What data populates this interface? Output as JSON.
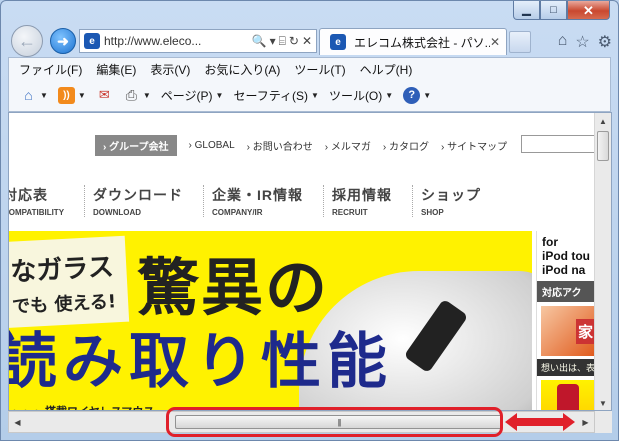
{
  "window": {
    "caption_buttons": {
      "minimize": "▁",
      "maximize": "□",
      "close": "✕"
    }
  },
  "nav": {
    "back_glyph": "←",
    "forward_glyph": "➜",
    "address": {
      "site_icon": "elecom-favicon",
      "url": "http://www.eleco...",
      "search_glyph": "🔍",
      "dropdown_glyph": "▾",
      "compat_glyph": "⌸",
      "refresh_glyph": "↻",
      "stop_glyph": "✕"
    },
    "tab": {
      "title": "エレコム株式会社 - パソ...",
      "close_glyph": "✕"
    },
    "right_icons": [
      "home-icon",
      "favorites-star-icon",
      "tools-gear-icon"
    ]
  },
  "menu_bar": [
    "ファイル(F)",
    "編集(E)",
    "表示(V)",
    "お気に入り(A)",
    "ツール(T)",
    "ヘルプ(H)"
  ],
  "command_bar": {
    "page": "ページ(P)",
    "safety": "セーフティ(S)",
    "tools": "ツール(O)"
  },
  "page": {
    "util_nav": {
      "group": "グループ会社",
      "links": [
        "GLOBAL",
        "お問い合わせ",
        "メルマガ",
        "カタログ",
        "サイトマップ"
      ],
      "prefix": "›"
    },
    "main_nav": [
      {
        "jp": "対応表",
        "en": "COMPATIBILITY"
      },
      {
        "jp": "ダウンロード",
        "en": "DOWNLOAD"
      },
      {
        "jp": "企業・IR情報",
        "en": "COMPANY/IR"
      },
      {
        "jp": "採用情報",
        "en": "RECRUIT"
      },
      {
        "jp": "ショップ",
        "en": "SHOP"
      }
    ],
    "banner": {
      "line1": "なガラス",
      "line2": "でも 使える!",
      "headline1": "驚異の",
      "headline2": "読み取り性能",
      "tag": "・・・ 搭載ワイヤレスマウス"
    },
    "side_ad": {
      "head1": "for",
      "head2": "iPod tou",
      "head3": "iPod na",
      "strip": "対応アク",
      "pic_text": "家",
      "note": "想い出は、表"
    }
  },
  "colors": {
    "banner_yellow": "#fff200",
    "headline_navy": "#1e2a8c",
    "highlight_red": "#e0202a",
    "close_red": "#c9482f"
  }
}
